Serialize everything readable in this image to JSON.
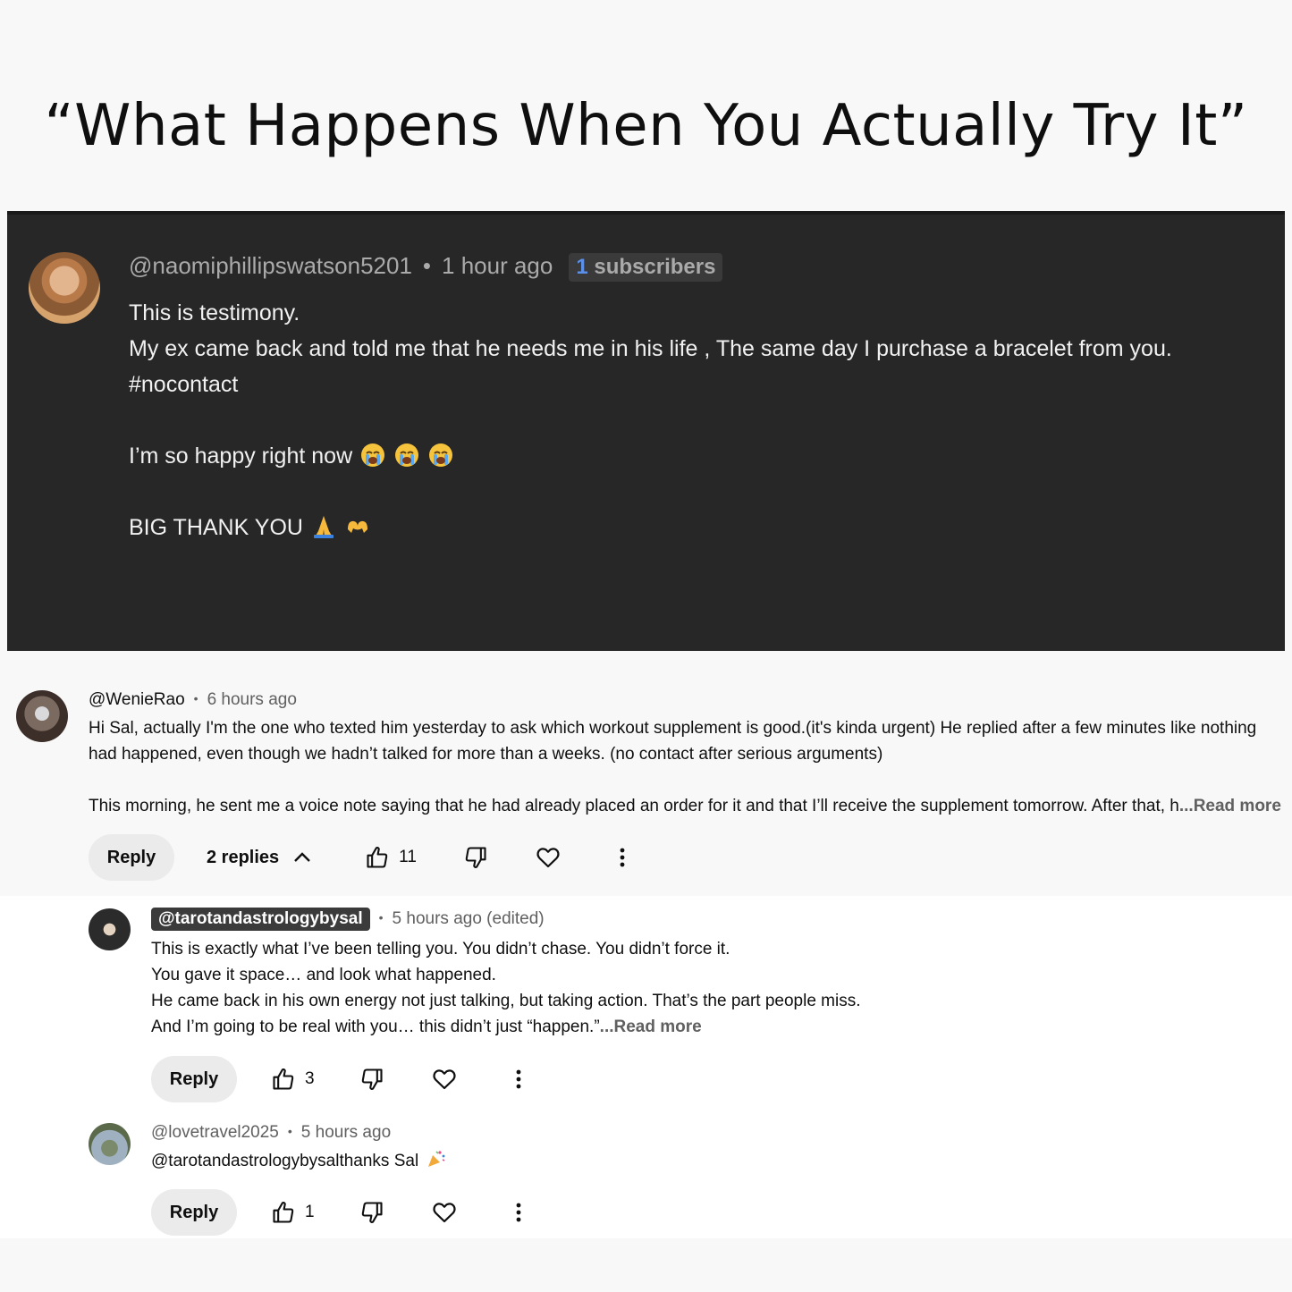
{
  "headline": "“What Happens When You Actually Try It”",
  "dark_comment": {
    "handle": "@naomiphillipswatson5201",
    "time": "1 hour ago",
    "sub_count": "1",
    "sub_label": "subscribers",
    "lines": [
      "This is testimony.",
      "My ex came back and told me that he needs me in his life , The same day I purchase a bracelet from you.",
      "#nocontact",
      "I’m so happy right now",
      "BIG THANK YOU"
    ],
    "emojis": [
      "crying-face",
      "crying-face",
      "crying-face",
      "folded-hands",
      "heart-hands"
    ]
  },
  "comment1": {
    "handle": "@WenieRao",
    "time": "6 hours ago",
    "lines": [
      "Hi Sal, actually I'm the one who texted him yesterday to ask which workout supplement is good.(it's kinda urgent) He replied after a few minutes like nothing",
      "had happened, even though we hadn’t talked for more than a weeks. (no contact after serious arguments)",
      "This morning, he sent me a voice note saying that he had already placed an order for it and that I’ll receive the supplement tomorrow. After that, h"
    ],
    "read_more": "...Read more",
    "reply_label": "Reply",
    "replies_label": "2 replies",
    "likes": "11"
  },
  "reply1": {
    "handle": "@tarotandastrologybysal",
    "time": "5 hours ago (edited)",
    "lines": [
      "This is exactly what I’ve been telling you. You didn’t chase. You didn’t force it.",
      "You gave it space… and look what happened.",
      "He came back in his own energy not just talking, but taking action. That’s the part people miss.",
      "And I’m going to be real with you… this didn’t just “happen.”"
    ],
    "read_more": "...Read more",
    "reply_label": "Reply",
    "likes": "3"
  },
  "reply2": {
    "handle": "@lovetravel2025",
    "time": "5 hours ago",
    "text": "@tarotandastrologybysalthanks Sal",
    "emoji": "party-popper",
    "reply_label": "Reply",
    "likes": "1"
  }
}
